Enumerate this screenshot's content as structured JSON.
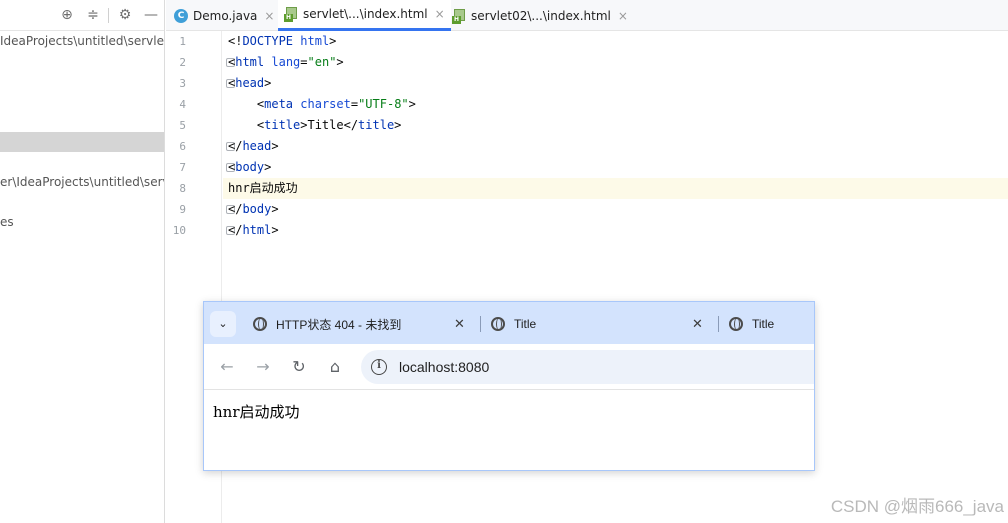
{
  "project_panel": {
    "rows": [
      {
        "text": "IdeaProjects\\untitled\\servlet",
        "selected": false
      },
      {
        "text": "",
        "selected": true
      },
      {
        "text": "er\\IdeaProjects\\untitled\\serv",
        "selected": false
      },
      {
        "text": "es",
        "selected": false
      }
    ]
  },
  "editor_tabs": [
    {
      "label": "Demo.java",
      "icon": "java-class-icon",
      "active": false
    },
    {
      "label": "servlet\\...\\index.html",
      "icon": "html-file-icon",
      "active": true
    },
    {
      "label": "servlet02\\...\\index.html",
      "icon": "html-file-icon",
      "active": false
    }
  ],
  "code": {
    "line_numbers": [
      "1",
      "2",
      "3",
      "4",
      "5",
      "6",
      "7",
      "8",
      "9",
      "10"
    ],
    "lines": [
      "<!DOCTYPE html>",
      "<html lang=\"en\">",
      "<head>",
      "    <meta charset=\"UTF-8\">",
      "    <title>Title</title>",
      "</head>",
      "<body>",
      "hnr启动成功",
      "</body>",
      "</html>"
    ],
    "highlighted_line": 8
  },
  "browser": {
    "tabs": [
      {
        "title": "HTTP状态 404 - 未找到"
      },
      {
        "title": "Title"
      },
      {
        "title": "Title"
      }
    ],
    "url": "localhost:8080",
    "page_text": "hnr启动成功"
  },
  "watermark": "CSDN @烟雨666_java",
  "colors": {
    "active_tab_underline": "#3574f0",
    "browser_tabstrip": "#d3e3fd",
    "highlight_line": "#fdfae8"
  }
}
